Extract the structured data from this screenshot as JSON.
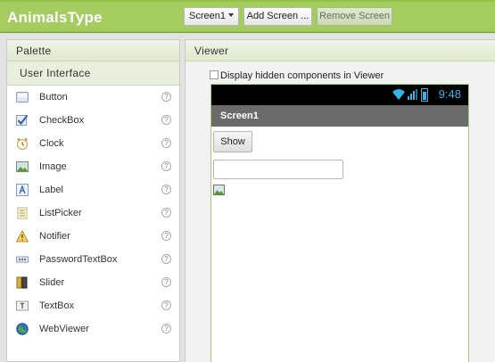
{
  "app": {
    "title": "AnimalsType"
  },
  "toolbar": {
    "screen_select": "Screen1",
    "add_screen": "Add Screen ...",
    "remove_screen": "Remove Screen"
  },
  "palette": {
    "title": "Palette",
    "category": "User Interface",
    "items": [
      {
        "label": "Button",
        "icon": "button-icon"
      },
      {
        "label": "CheckBox",
        "icon": "checkbox-icon"
      },
      {
        "label": "Clock",
        "icon": "clock-icon"
      },
      {
        "label": "Image",
        "icon": "image-icon"
      },
      {
        "label": "Label",
        "icon": "label-icon"
      },
      {
        "label": "ListPicker",
        "icon": "listpicker-icon"
      },
      {
        "label": "Notifier",
        "icon": "notifier-icon"
      },
      {
        "label": "PasswordTextBox",
        "icon": "password-icon"
      },
      {
        "label": "Slider",
        "icon": "slider-icon"
      },
      {
        "label": "TextBox",
        "icon": "textbox-icon"
      },
      {
        "label": "WebViewer",
        "icon": "webviewer-icon"
      }
    ],
    "help_glyph": "?"
  },
  "viewer": {
    "title": "Viewer",
    "hidden_components_label": "Display hidden components in Viewer",
    "hidden_components_checked": false,
    "phone": {
      "status_time": "9:48",
      "screen_title": "Screen1",
      "button_label": "Show",
      "textbox_value": ""
    }
  },
  "colors": {
    "topbar": "#a4cc5f",
    "status_accent": "#35b5e5",
    "titlebar": "#6b6b6b"
  }
}
